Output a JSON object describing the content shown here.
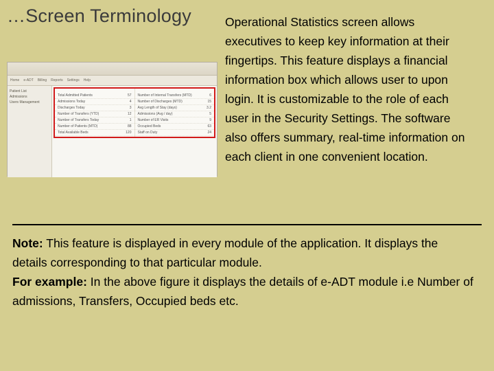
{
  "title": "…Screen Terminology",
  "body": "Operational Statistics screen allows executives to keep key information at their fingertips. This feature displays a financial information box which allows user to upon login.  It is customizable to the role of each user in the Security Settings.  The software also offers summary, real-time information on each client in one convenient location.",
  "note": {
    "label": "Note:",
    "line1": " This feature is displayed in every module of the application. It displays the details corresponding to that particular module.",
    "example_label": "For example:",
    "line2": " In the above figure it displays the details of e-ADT module i.e Number of admissions, Transfers, Occupied beds etc."
  },
  "screenshot": {
    "tabs": [
      "Home",
      "e-ADT",
      "Billing",
      "Reports",
      "Settings",
      "Help"
    ],
    "side_items": [
      "Patient List",
      "Admissions",
      "Users Management"
    ],
    "stats_left": [
      {
        "l": "Total Admitted Patients",
        "r": "57"
      },
      {
        "l": "Admissions Today",
        "r": "4"
      },
      {
        "l": "Discharges Today",
        "r": "3"
      },
      {
        "l": "Number of Transfers (YTD)",
        "r": "12"
      },
      {
        "l": "Number of Transfers Today",
        "r": "1"
      },
      {
        "l": "Number of Patients (MTD)",
        "r": "88"
      },
      {
        "l": "Total Available Beds",
        "r": "120"
      }
    ],
    "stats_right": [
      {
        "l": "Number of Internal Transfers (MTD)",
        "r": "6"
      },
      {
        "l": "Number of Discharges (MTD)",
        "r": "15"
      },
      {
        "l": "Avg Length of Stay (days)",
        "r": "3.2"
      },
      {
        "l": "Admissions (Avg / day)",
        "r": "5"
      },
      {
        "l": "Number of ER Visits",
        "r": "9"
      },
      {
        "l": "Occupied Beds",
        "r": "63"
      },
      {
        "l": "Staff on Duty",
        "r": "24"
      }
    ]
  }
}
